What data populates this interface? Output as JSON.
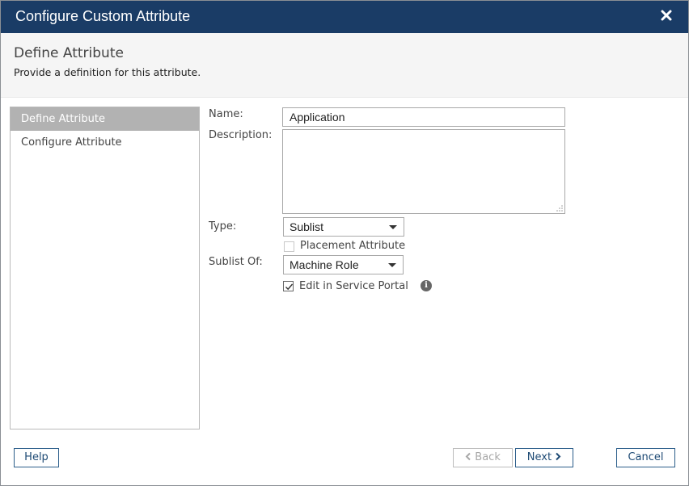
{
  "window": {
    "title": "Configure Custom Attribute",
    "close_icon": "close-icon"
  },
  "header": {
    "title": "Define Attribute",
    "subtitle": "Provide a definition for this attribute."
  },
  "steps": [
    {
      "label": "Define Attribute",
      "active": true
    },
    {
      "label": "Configure Attribute",
      "active": false
    }
  ],
  "form": {
    "name_label": "Name:",
    "name_value": "Application",
    "description_label": "Description:",
    "description_value": "",
    "type_label": "Type:",
    "type_value": "Sublist",
    "placement_label": "Placement Attribute",
    "placement_checked": false,
    "sublist_label": "Sublist Of:",
    "sublist_value": "Machine Role",
    "service_portal_label": "Edit in Service Portal",
    "service_portal_checked": true,
    "info_icon": "info-icon"
  },
  "footer": {
    "help_label": "Help",
    "back_label": "Back",
    "next_label": "Next",
    "cancel_label": "Cancel"
  },
  "colors": {
    "titlebar": "#1a3c66",
    "active_step": "#b2b2b2",
    "button_border": "#2b5d8a"
  }
}
